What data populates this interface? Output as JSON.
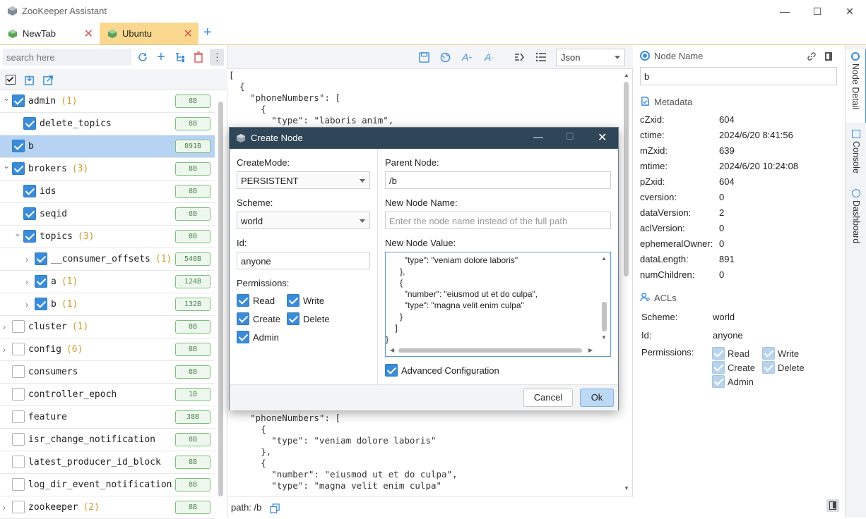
{
  "window": {
    "title": "ZooKeeper Assistant",
    "minimize": "—",
    "maximize": "☐",
    "close": "✕"
  },
  "tabs": [
    {
      "label": "NewTab",
      "active": false
    },
    {
      "label": "Ubuntu",
      "active": true
    }
  ],
  "tabs_add": "+",
  "left": {
    "search_placeholder": "search here",
    "tree": [
      {
        "name": "admin",
        "count": "(1)",
        "size": "8B",
        "checked": true,
        "expanded": true
      },
      {
        "name": "delete_topics",
        "count": "",
        "size": "8B",
        "checked": true
      },
      {
        "name": "b",
        "count": "",
        "size": "891B",
        "checked": true,
        "selected": true
      },
      {
        "name": "brokers",
        "count": "(3)",
        "size": "8B",
        "checked": true,
        "expanded": true
      },
      {
        "name": "ids",
        "count": "",
        "size": "8B",
        "checked": true
      },
      {
        "name": "seqid",
        "count": "",
        "size": "8B",
        "checked": true
      },
      {
        "name": "topics",
        "count": "(3)",
        "size": "8B",
        "checked": true,
        "expanded": true
      },
      {
        "name": "__consumer_offsets",
        "count": "(1)",
        "size": "548B",
        "checked": true
      },
      {
        "name": "a",
        "count": "(1)",
        "size": "124B",
        "checked": true
      },
      {
        "name": "b",
        "count": "(1)",
        "size": "132B",
        "checked": true
      },
      {
        "name": "cluster",
        "count": "(1)",
        "size": "8B",
        "checked": false
      },
      {
        "name": "config",
        "count": "(6)",
        "size": "8B",
        "checked": false
      },
      {
        "name": "consumers",
        "count": "",
        "size": "8B",
        "checked": false
      },
      {
        "name": "controller_epoch",
        "count": "",
        "size": "1B",
        "checked": false
      },
      {
        "name": "feature",
        "count": "",
        "size": "38B",
        "checked": false
      },
      {
        "name": "isr_change_notification",
        "count": "",
        "size": "8B",
        "checked": false
      },
      {
        "name": "latest_producer_id_block",
        "count": "",
        "size": "8B",
        "checked": false
      },
      {
        "name": "log_dir_event_notification",
        "count": "",
        "size": "8B",
        "checked": false
      },
      {
        "name": "zookeeper",
        "count": "(2)",
        "size": "8B",
        "checked": false
      }
    ]
  },
  "editor": {
    "format": "Json",
    "top_lines": [
      "[",
      "  {",
      "    \"phoneNumbers\": [",
      "      {",
      "        \"type\": \"laboris anim\","
    ],
    "bottom_lines": [
      "    \"phoneNumbers\": [",
      "      {",
      "        \"type\": \"veniam dolore laboris\"",
      "      },",
      "      {",
      "        \"number\": \"eiusmod ut et do culpa\",",
      "        \"type\": \"magna velit enim culpa\""
    ],
    "path_label": "path: /b"
  },
  "details": {
    "node_name_title": "Node Name",
    "node_name": "b",
    "metadata_title": "Metadata",
    "metadata": [
      {
        "k": "cZxid:",
        "v": "604"
      },
      {
        "k": "ctime:",
        "v": "2024/6/20 8:41:56"
      },
      {
        "k": "mZxid:",
        "v": "639"
      },
      {
        "k": "mtime:",
        "v": "2024/6/20 10:24:08"
      },
      {
        "k": "pZxid:",
        "v": "604"
      },
      {
        "k": "cversion:",
        "v": "0"
      },
      {
        "k": "dataVersion:",
        "v": "2"
      },
      {
        "k": "aclVersion:",
        "v": "0"
      },
      {
        "k": "ephemeralOwner:",
        "v": "0"
      },
      {
        "k": "dataLength:",
        "v": "891"
      },
      {
        "k": "numChildren:",
        "v": "0"
      }
    ],
    "acls_title": "ACLs",
    "acl_scheme_label": "Scheme:",
    "acl_scheme": "world",
    "acl_id_label": "Id:",
    "acl_id": "anyone",
    "acl_permissions_label": "Permissions:",
    "perm_read": "Read",
    "perm_write": "Write",
    "perm_create": "Create",
    "perm_delete": "Delete",
    "perm_admin": "Admin"
  },
  "side_tabs": [
    "Node Detail",
    "Console",
    "Dashboard"
  ],
  "dialog": {
    "title": "Create Node",
    "create_mode_label": "CreateMode:",
    "create_mode": "PERSISTENT",
    "scheme_label": "Scheme:",
    "scheme": "world",
    "id_label": "Id:",
    "id": "anyone",
    "permissions_label": "Permissions:",
    "perm_read": "Read",
    "perm_write": "Write",
    "perm_create": "Create",
    "perm_delete": "Delete",
    "perm_admin": "Admin",
    "parent_label": "Parent Node:",
    "parent": "/b",
    "new_name_label": "New Node Name:",
    "new_name_placeholder": "Enter the node name instead of the full path",
    "new_value_label": "New Node Value:",
    "value_lines": [
      "        \"type\": \"veniam dolore laboris\"",
      "      },",
      "      {",
      "        \"number\": \"eiusmod ut et do culpa\",",
      "        \"type\": \"magna velit enim culpa\"",
      "      }",
      "    ]",
      "}"
    ],
    "advanced_label": "Advanced Configuration",
    "cancel": "Cancel",
    "ok": "Ok"
  },
  "colors": {
    "accent": "#3b8cd8",
    "selected_row": "#b7d3f3",
    "tab_active": "#fbd88f",
    "dialog_title": "#2f4659",
    "size_badge": "#7cbf7c"
  }
}
